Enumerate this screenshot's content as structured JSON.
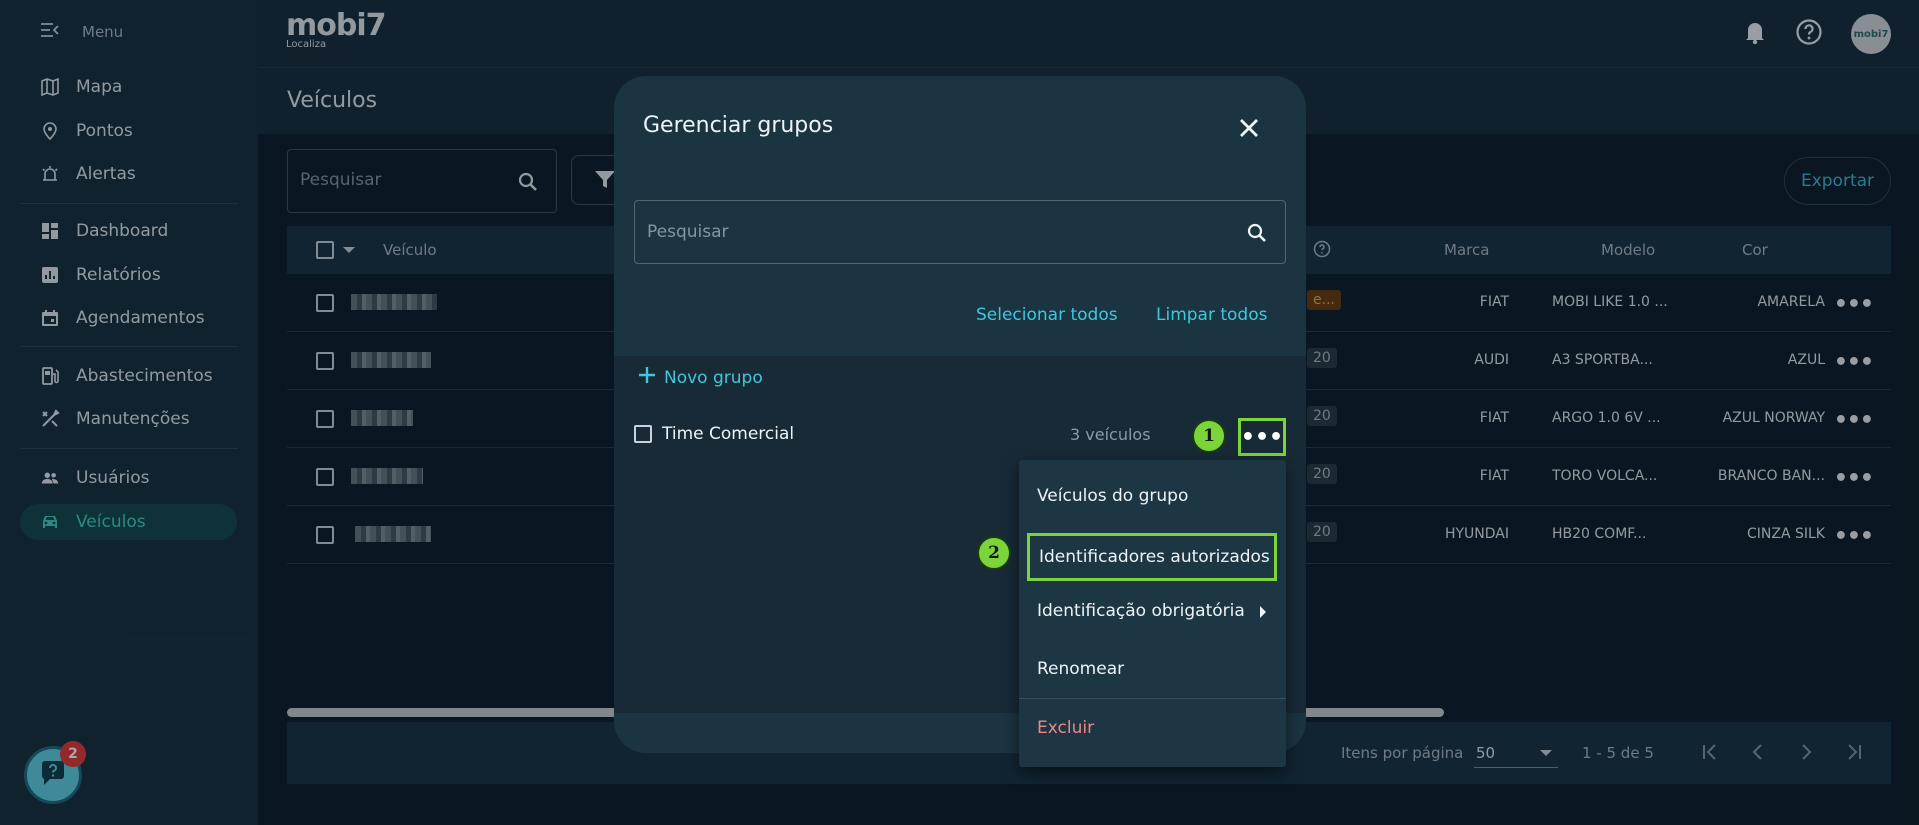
{
  "sidebar": {
    "menu_label": "Menu",
    "items": [
      {
        "label": "Mapa",
        "icon": "map-icon"
      },
      {
        "label": "Pontos",
        "icon": "pin-icon"
      },
      {
        "label": "Alertas",
        "icon": "alarm-icon"
      },
      {
        "label": "Dashboard",
        "icon": "dashboard-icon"
      },
      {
        "label": "Relatórios",
        "icon": "report-icon"
      },
      {
        "label": "Agendamentos",
        "icon": "calendar-icon"
      },
      {
        "label": "Abastecimentos",
        "icon": "fuel-icon"
      },
      {
        "label": "Manutenções",
        "icon": "tools-icon"
      },
      {
        "label": "Usuários",
        "icon": "users-icon"
      },
      {
        "label": "Veículos",
        "icon": "car-icon",
        "active": true
      }
    ]
  },
  "topbar": {
    "logo_brand": "mobi7",
    "logo_sub": "Localiza",
    "avatar_text": "mobi7"
  },
  "page": {
    "title": "Veículos",
    "search_placeholder": "Pesquisar",
    "export_label": "Exportar"
  },
  "table": {
    "headers": {
      "vehicle": "Veículo",
      "brand": "Marca",
      "model": "Modelo",
      "color": "Cor"
    },
    "rows": [
      {
        "chip": "e...",
        "brand": "FIAT",
        "model": "MOBI LIKE 1.0 ...",
        "color": "AMARELA"
      },
      {
        "chip": "20",
        "brand": "AUDI",
        "model": "A3 SPORTBA...",
        "color": "AZUL"
      },
      {
        "chip": "20",
        "brand": "FIAT",
        "model": "ARGO 1.0 6V ...",
        "color": "AZUL NORWAY"
      },
      {
        "chip": "20",
        "brand": "FIAT",
        "model": "TORO VOLCA...",
        "color": "BRANCO BAN..."
      },
      {
        "chip": "20",
        "brand": "HYUNDAI",
        "model": "HB20 COMF...",
        "color": "CINZA SILK"
      }
    ],
    "more_label": "•••"
  },
  "pager": {
    "items_per_page_label": "Itens por página",
    "items_per_page_value": "50",
    "range_label": "1 - 5 de 5"
  },
  "help": {
    "badge_count": "2"
  },
  "modal": {
    "title": "Gerenciar grupos",
    "search_placeholder": "Pesquisar",
    "select_all_label": "Selecionar todos",
    "clear_all_label": "Limpar todos",
    "new_group_label": "Novo grupo",
    "group": {
      "name": "Time Comercial",
      "count": "3 veículos"
    },
    "more_label": "•••"
  },
  "callouts": {
    "one": "1",
    "two": "2"
  },
  "dropdown": {
    "items": [
      {
        "label": "Veículos do grupo"
      },
      {
        "label": "Identificadores autorizados"
      },
      {
        "label": "Identificação obrigatória"
      },
      {
        "label": "Renomear"
      },
      {
        "label": "Excluir"
      }
    ]
  },
  "colors": {
    "accent": "#42c6dd",
    "active_nav": "#3fd0c4",
    "highlight": "#7ad43a",
    "danger": "#f08686"
  }
}
